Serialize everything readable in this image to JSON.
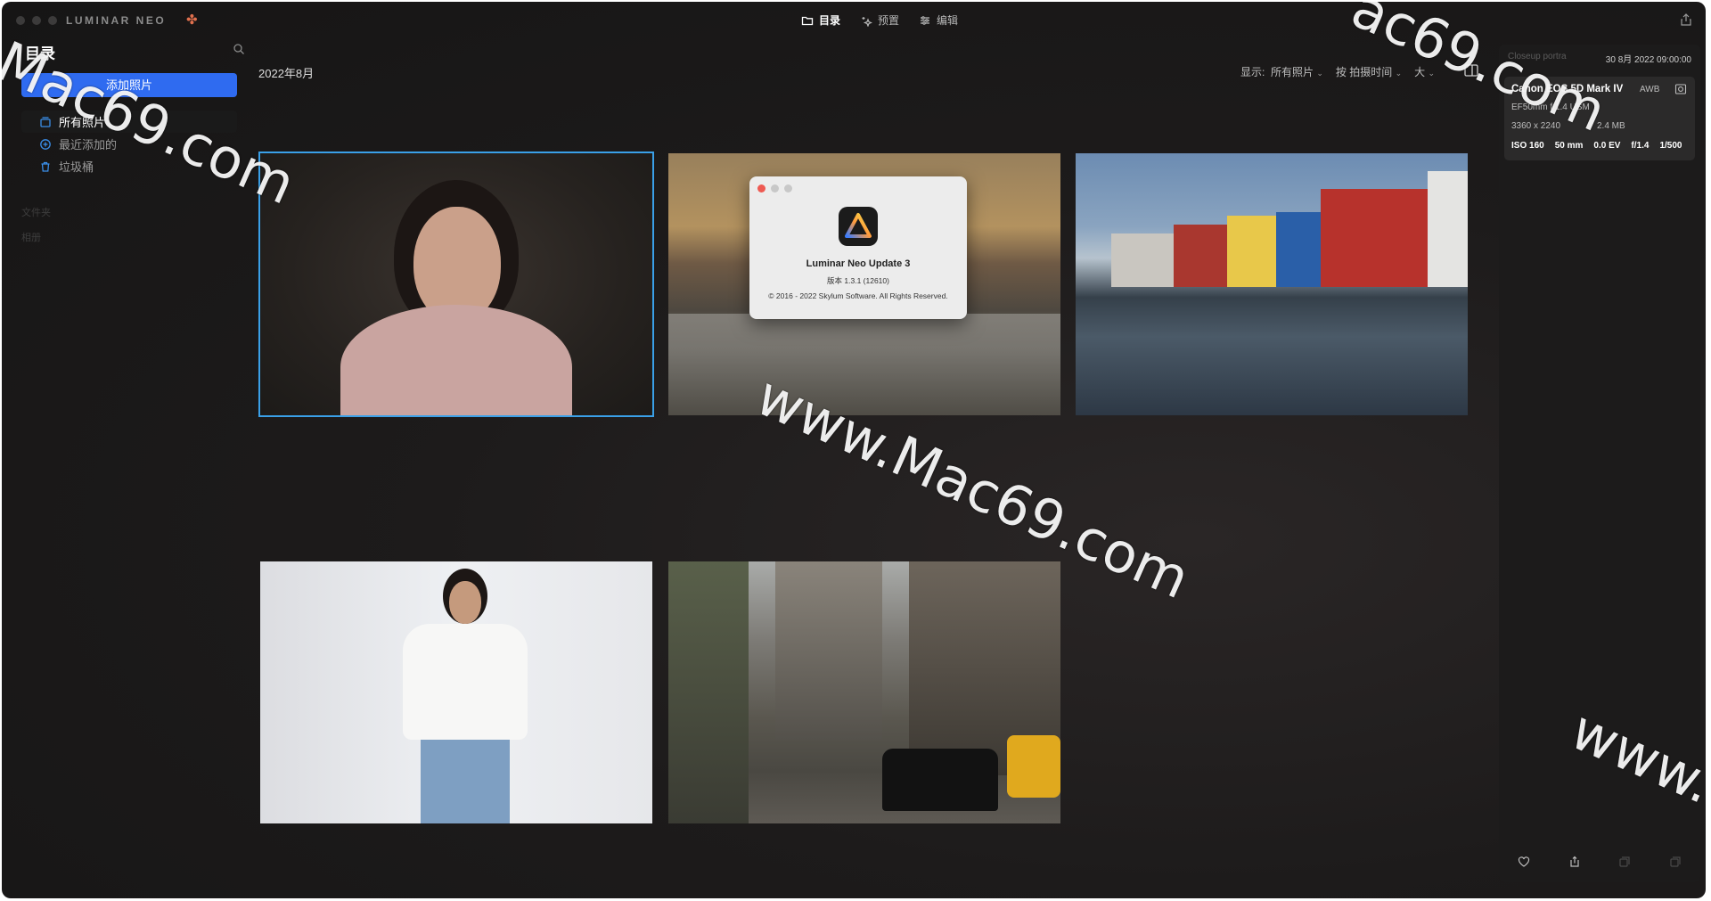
{
  "app": {
    "logo_text": "LUMINAR",
    "logo_neo": "NEO"
  },
  "modes": [
    {
      "label": "目录",
      "icon": "folder-icon",
      "active": true
    },
    {
      "label": "预置",
      "icon": "sparkle-icon",
      "active": false
    },
    {
      "label": "编辑",
      "icon": "sliders-icon",
      "active": false
    }
  ],
  "sidebar": {
    "title": "目录",
    "add_button": "添加照片",
    "items": [
      {
        "label": "所有照片",
        "icon": "photos-icon",
        "active": true
      },
      {
        "label": "最近添加的",
        "icon": "plus-circle-icon",
        "active": false
      },
      {
        "label": "垃圾桶",
        "icon": "trash-icon",
        "active": false
      }
    ],
    "sections": [
      "文件夹",
      "相册"
    ]
  },
  "main": {
    "month": "2022年8月",
    "view": {
      "show_label": "显示:",
      "show_value": "所有照片",
      "sort_value": "按 拍摄时间",
      "size_value": "大"
    },
    "photos": [
      {
        "name": "portrait-pink-dress",
        "selected": true
      },
      {
        "name": "beach-sunset",
        "selected": false
      },
      {
        "name": "colorful-harbor-houses",
        "selected": false
      },
      {
        "name": "woman-white-blouse",
        "selected": false
      },
      {
        "name": "city-street-taxis",
        "selected": false
      }
    ]
  },
  "about_dialog": {
    "app_name": "Luminar Neo Update 3",
    "version": "版本 1.3.1 (12610)",
    "copyright": "© 2016 - 2022 Skylum Software. All Rights Reserved."
  },
  "info_panel": {
    "filename": "Closeup portra",
    "date": "30 8月 2022 09:00:00",
    "camera": "Canon EOS 5D Mark IV",
    "white_balance": "AWB",
    "lens": "EF50mm f/1.4 USM",
    "resolution": "3360 x 2240",
    "file_size": "2.4 MB",
    "exif": {
      "iso": "ISO 160",
      "focal": "50 mm",
      "ev": "0.0 EV",
      "aperture": "f/1.4",
      "shutter": "1/500"
    }
  },
  "watermarks": [
    "Mac69.com",
    "www.Mac69.com",
    "ac69.com",
    "www."
  ],
  "colors": {
    "accent": "#2f6bf0",
    "selection": "#3aa0e8",
    "background": "#1d1b1b"
  }
}
